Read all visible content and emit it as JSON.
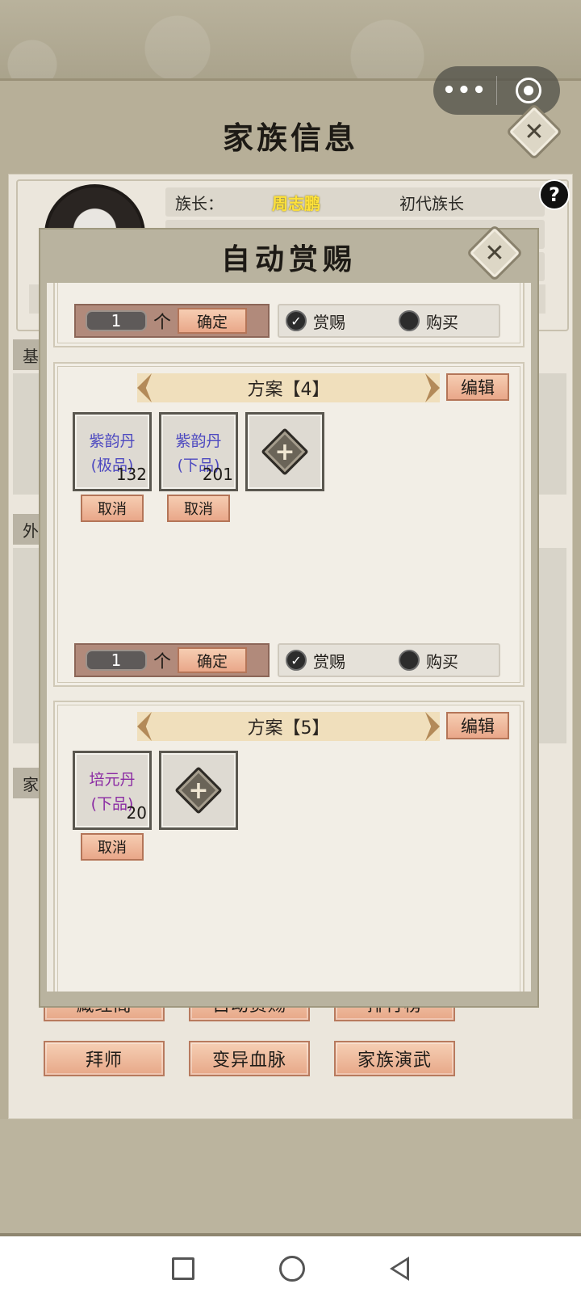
{
  "page": {
    "title": "家族信息"
  },
  "leader": {
    "label": "族长：",
    "name": "周志鹏",
    "rank": "初代族长"
  },
  "side_tags": [
    "基",
    "外",
    "家"
  ],
  "bottom_buttons": [
    "藏经阁",
    "自动赏赐",
    "排行榜",
    "拜师",
    "变异血脉",
    "家族演武"
  ],
  "modal": {
    "title": "自动赏赐",
    "top_card": {
      "qty": "1",
      "unit": "个",
      "confirm": "确定",
      "reward": "赏赐",
      "buy": "购买"
    },
    "plans": [
      {
        "header": "方案【4】",
        "edit": "编辑",
        "items": [
          {
            "name": "紫韵丹",
            "grade": "(极品)",
            "count": "132",
            "cancel": "取消"
          },
          {
            "name": "紫韵丹",
            "grade": "(下品)",
            "count": "201",
            "cancel": "取消"
          }
        ],
        "qty": "1",
        "unit": "个",
        "confirm": "确定",
        "reward": "赏赐",
        "buy": "购买"
      },
      {
        "header": "方案【5】",
        "edit": "编辑",
        "items": [
          {
            "name": "培元丹",
            "grade": "(下品)",
            "count": "20",
            "cancel": "取消"
          }
        ]
      }
    ]
  },
  "colors": {
    "leader_name": "#ffe23a",
    "item_blue": "#4d49c0",
    "item_purple": "#8a2aa3",
    "button_peach": "#e9a789"
  },
  "icons": {
    "more": "more-icon",
    "target": "target-icon",
    "close": "close-icon",
    "help": "help-icon",
    "add": "add-icon",
    "check": "check-icon",
    "nav_square": "recent-apps-icon",
    "nav_circle": "home-icon",
    "nav_back": "back-icon"
  }
}
